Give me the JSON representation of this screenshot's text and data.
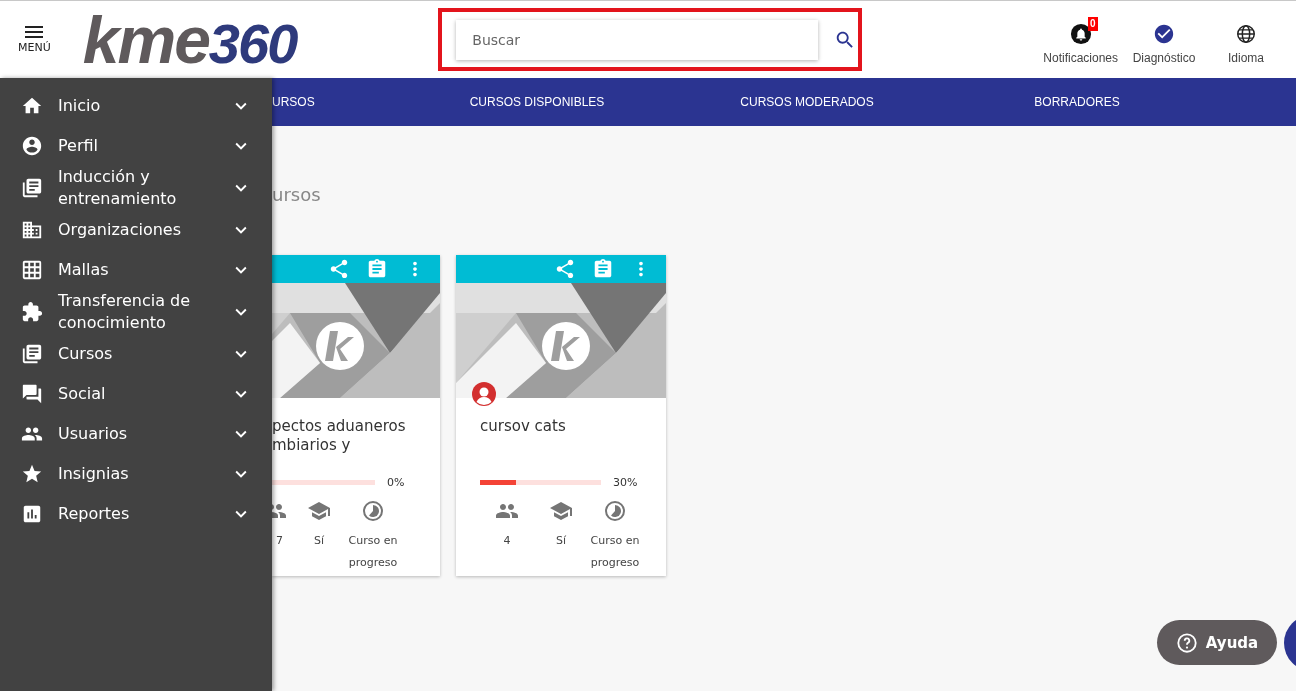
{
  "header": {
    "menu_label": "MENÚ",
    "logo": {
      "word": "kme",
      "number": "360"
    },
    "search": {
      "placeholder": "Buscar",
      "highlighted": true
    },
    "actions": [
      {
        "label": "Notificaciones",
        "badge": "0"
      },
      {
        "label": "Diagnóstico"
      },
      {
        "label": "Idioma"
      }
    ]
  },
  "tabs": [
    {
      "label": "URSOS",
      "selected": false
    },
    {
      "label": "CURSOS DISPONIBLES",
      "selected": false
    },
    {
      "label": "CURSOS MODERADOS",
      "selected": false
    },
    {
      "label": "BORRADORES",
      "selected": false
    }
  ],
  "heading": "ursos",
  "sidebar": {
    "items": [
      {
        "label": "Inicio",
        "expanded": false
      },
      {
        "label": "Perfil",
        "expanded": false
      },
      {
        "label": "Inducción y entrenamiento",
        "expanded": false
      },
      {
        "label": "Organizaciones",
        "expanded": false
      },
      {
        "label": "Mallas",
        "expanded": false
      },
      {
        "label": "Transferencia de conocimiento",
        "expanded": false
      },
      {
        "label": "Cursos",
        "expanded": false
      },
      {
        "label": "Social",
        "expanded": false
      },
      {
        "label": "Usuarios",
        "expanded": false
      },
      {
        "label": "Insignias",
        "expanded": false
      },
      {
        "label": "Reportes",
        "expanded": false
      }
    ]
  },
  "courses": [
    {
      "title": "pectos aduaneros\nmbiarios y",
      "partial": true,
      "avatar": false,
      "level": 0,
      "reading": "0%",
      "stats": [
        "7",
        "Sí",
        "Curso en progreso"
      ]
    },
    {
      "title": "cursov cats",
      "partial": false,
      "avatar": true,
      "level": 0.3,
      "reading": "30%",
      "stats": [
        "4",
        "Sí",
        "Curso en progreso"
      ]
    }
  ],
  "help_button": "Ayuda"
}
